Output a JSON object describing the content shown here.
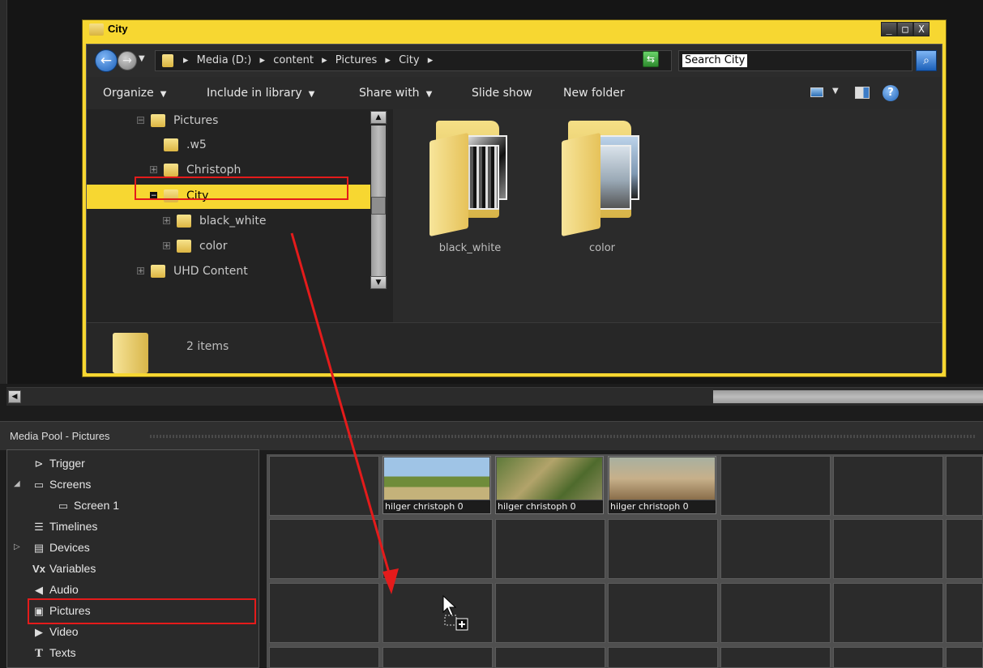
{
  "explorer": {
    "title": "City",
    "window_buttons": {
      "minimize": "_",
      "maximize": "□",
      "close": "X"
    },
    "address": {
      "breadcrumb": [
        "Media (D:)",
        "content",
        "Pictures",
        "City"
      ],
      "separator": "▸"
    },
    "search": {
      "value": "Search City"
    },
    "toolbar": {
      "organize": "Organize",
      "include_in_library": "Include in library",
      "share_with": "Share with",
      "slide_show": "Slide show",
      "new_folder": "New folder",
      "help": "?"
    },
    "tree": [
      {
        "label": "Pictures",
        "expander": "−"
      },
      {
        "label": ".w5",
        "expander": ""
      },
      {
        "label": "Christoph",
        "expander": "+"
      },
      {
        "label": "City",
        "expander": "−",
        "selected": true
      },
      {
        "label": "black_white",
        "expander": "+"
      },
      {
        "label": "color",
        "expander": "+"
      },
      {
        "label": "UHD Content",
        "expander": "+"
      }
    ],
    "folders": [
      {
        "label": "black_white"
      },
      {
        "label": "color"
      }
    ],
    "details": {
      "count": "2 items"
    }
  },
  "media_pool": {
    "title": "Media Pool - Pictures",
    "tree": [
      {
        "label": "Trigger",
        "icon": "trigger-icon",
        "glyph": "⊳"
      },
      {
        "label": "Screens",
        "icon": "screens-icon",
        "glyph": "▭",
        "arrow": "◢"
      },
      {
        "label": "Screen 1",
        "icon": "screen-icon",
        "glyph": "▭"
      },
      {
        "label": "Timelines",
        "icon": "timelines-icon",
        "glyph": "☰"
      },
      {
        "label": "Devices",
        "icon": "devices-icon",
        "glyph": "▤",
        "arrow": "▷"
      },
      {
        "label": "Variables",
        "icon": "variables-icon",
        "glyph": "Vx"
      },
      {
        "label": "Audio",
        "icon": "audio-icon",
        "glyph": "◀"
      },
      {
        "label": "Pictures",
        "icon": "pictures-icon",
        "glyph": "▣"
      },
      {
        "label": "Video",
        "icon": "video-icon",
        "glyph": "▶"
      },
      {
        "label": "Texts",
        "icon": "texts-icon",
        "glyph": "T"
      }
    ],
    "thumbnails": [
      {
        "caption": "hilger christoph 0"
      },
      {
        "caption": "hilger christoph 0"
      },
      {
        "caption": "hilger christoph 0"
      }
    ]
  },
  "colors": {
    "explorer_frame": "#f7d731",
    "highlight": "#e41b1b",
    "background": "#1c1c1c"
  }
}
